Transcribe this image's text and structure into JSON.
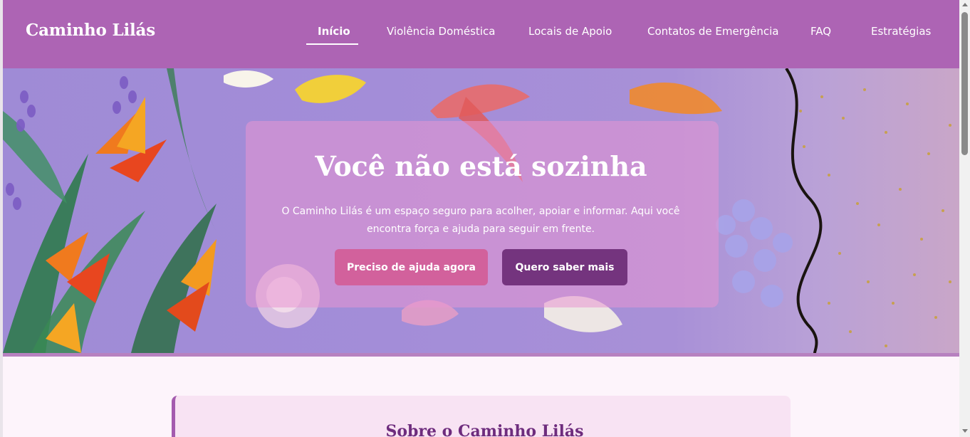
{
  "brand": "Caminho Lilás",
  "nav": [
    {
      "label": "Início",
      "active": true
    },
    {
      "label": "Violência Doméstica",
      "active": false
    },
    {
      "label": "Locais de Apoio",
      "active": false
    },
    {
      "label": "Contatos de Emergência",
      "active": false
    },
    {
      "label": "FAQ",
      "active": false
    },
    {
      "label": "Estratégias",
      "active": false
    }
  ],
  "hero": {
    "title": "Você não está sozinha",
    "text": "O Caminho Lilás é um espaço seguro para acolher, apoiar e informar. Aqui você encontra força e ajuda para seguir em frente.",
    "primary_button": "Preciso de ajuda agora",
    "secondary_button": "Quero saber mais"
  },
  "about": {
    "title": "Sobre o Caminho Lilás"
  },
  "colors": {
    "header": "#ad64b4",
    "primary_button": "#d2619c",
    "secondary_button": "#74347e",
    "heading": "#6e2c7d"
  }
}
